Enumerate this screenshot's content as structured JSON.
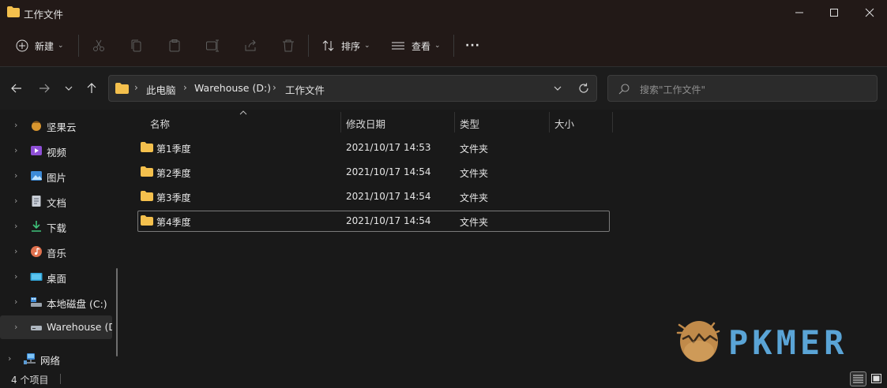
{
  "window": {
    "title": "工作文件"
  },
  "toolbar": {
    "new_label": "新建",
    "sort_label": "排序",
    "view_label": "查看",
    "more_label": "···"
  },
  "address": {
    "crumbs": [
      "此电脑",
      "Warehouse (D:)",
      "工作文件"
    ]
  },
  "search": {
    "placeholder": "搜索\"工作文件\""
  },
  "sidebar": {
    "items": [
      {
        "label": "坚果云",
        "icon": "nut-cloud-icon"
      },
      {
        "label": "视频",
        "icon": "video-icon"
      },
      {
        "label": "图片",
        "icon": "pictures-icon"
      },
      {
        "label": "文档",
        "icon": "documents-icon"
      },
      {
        "label": "下载",
        "icon": "download-icon"
      },
      {
        "label": "音乐",
        "icon": "music-icon"
      },
      {
        "label": "桌面",
        "icon": "desktop-icon"
      },
      {
        "label": "本地磁盘 (C:)",
        "icon": "drive-c-icon"
      },
      {
        "label": "Warehouse (D",
        "icon": "drive-d-icon",
        "selected": true
      },
      {
        "label": "网络",
        "icon": "network-icon"
      }
    ]
  },
  "list": {
    "columns": [
      "名称",
      "修改日期",
      "类型",
      "大小"
    ],
    "rows": [
      {
        "name": "第1季度",
        "date": "2021/10/17 14:53",
        "type": "文件夹",
        "size": ""
      },
      {
        "name": "第2季度",
        "date": "2021/10/17 14:54",
        "type": "文件夹",
        "size": ""
      },
      {
        "name": "第3季度",
        "date": "2021/10/17 14:54",
        "type": "文件夹",
        "size": ""
      },
      {
        "name": "第4季度",
        "date": "2021/10/17 14:54",
        "type": "文件夹",
        "size": "",
        "selected": true
      }
    ]
  },
  "status": {
    "count_text": "4 个项目"
  },
  "watermark": {
    "text": "PKMER"
  },
  "colors": {
    "folder": "#f4c04d",
    "accent": "#4cc2ff",
    "watermark": "#5aa4d6",
    "logo_nut": "#c08a4a"
  }
}
